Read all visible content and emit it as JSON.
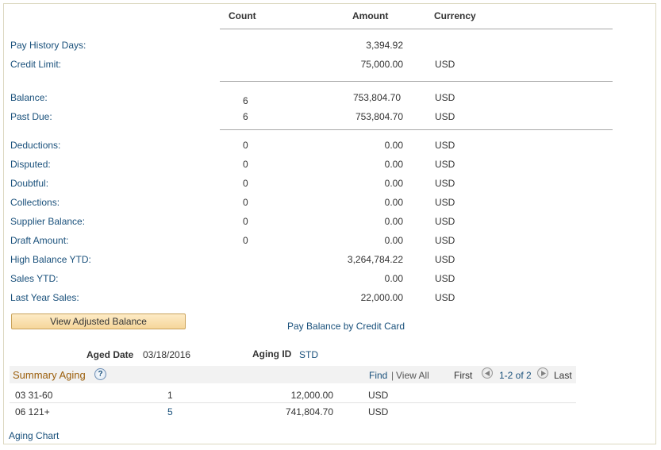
{
  "headers": {
    "count": "Count",
    "amount": "Amount",
    "currency": "Currency"
  },
  "group1": [
    {
      "label": "Pay History Days:",
      "count": "",
      "amount": "3,394.92",
      "currency": ""
    },
    {
      "label": "Credit Limit:",
      "count": "",
      "amount": "75,000.00",
      "currency": "USD"
    }
  ],
  "group2": [
    {
      "label": "Balance:",
      "count": "6",
      "amount": "753,804.70",
      "currency": "USD"
    },
    {
      "label": "Past Due:",
      "count": "6",
      "amount": "753,804.70",
      "currency": "USD"
    }
  ],
  "group3": [
    {
      "label": "Deductions:",
      "count": "0",
      "amount": "0.00",
      "currency": "USD"
    },
    {
      "label": "Disputed:",
      "count": "0",
      "amount": "0.00",
      "currency": "USD"
    },
    {
      "label": "Doubtful:",
      "count": "0",
      "amount": "0.00",
      "currency": "USD"
    },
    {
      "label": "Collections:",
      "count": "0",
      "amount": "0.00",
      "currency": "USD"
    },
    {
      "label": "Supplier Balance:",
      "count": "0",
      "amount": "0.00",
      "currency": "USD"
    },
    {
      "label": "Draft Amount:",
      "count": "0",
      "amount": "0.00",
      "currency": "USD"
    },
    {
      "label": "High Balance YTD:",
      "count": "",
      "amount": "3,264,784.22",
      "currency": "USD"
    },
    {
      "label": "Sales YTD:",
      "count": "",
      "amount": "0.00",
      "currency": "USD"
    },
    {
      "label": "Last Year Sales:",
      "count": "",
      "amount": "22,000.00",
      "currency": "USD"
    }
  ],
  "actions": {
    "view_adjusted_balance": "View Adjusted Balance",
    "pay_balance_by_credit_card": "Pay Balance by Credit Card"
  },
  "aging": {
    "aged_date_label": "Aged Date",
    "aged_date_value": "03/18/2016",
    "aging_id_label": "Aging ID",
    "aging_id_value": "STD"
  },
  "summary_aging": {
    "title": "Summary Aging",
    "help": "?",
    "find": "Find",
    "separator": "|",
    "view_all": "View All",
    "first": "First",
    "range": "1-2 of 2",
    "last": "Last",
    "rows": [
      {
        "bucket": "03 31-60",
        "count": "1",
        "amount": "12,000.00",
        "currency": "USD"
      },
      {
        "bucket": "06 121+",
        "count": "5",
        "amount": "741,804.70",
        "currency": "USD"
      }
    ]
  },
  "aging_chart": "Aging Chart",
  "colors": {
    "label": "#19507b",
    "title": "#9b5e0b",
    "button": "#f6d69a"
  }
}
